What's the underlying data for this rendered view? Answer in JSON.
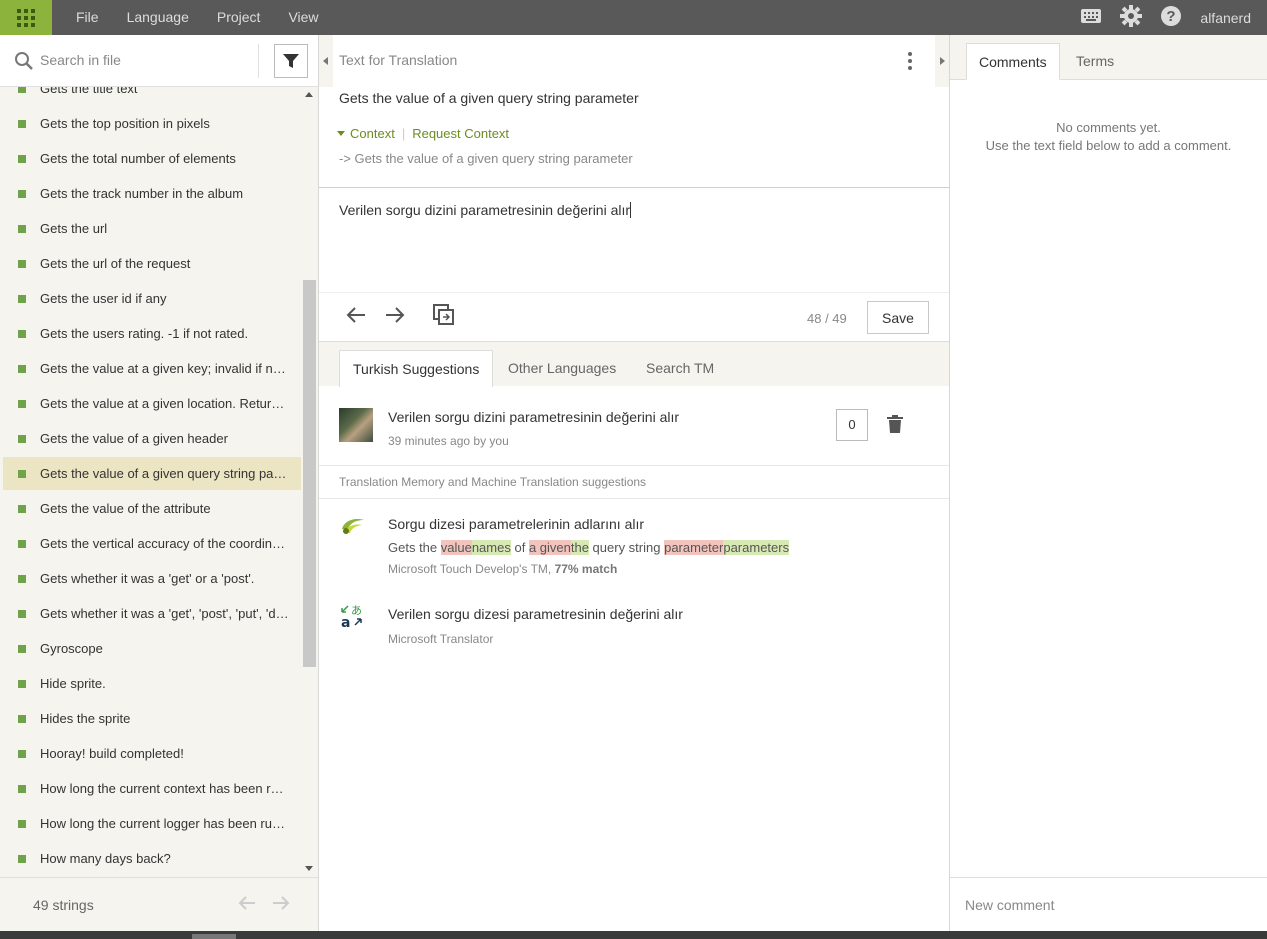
{
  "topbar": {
    "menu": [
      "File",
      "Language",
      "Project",
      "View"
    ],
    "username": "alfanerd",
    "accent": "#8cb43c"
  },
  "left": {
    "search_placeholder": "Search in file",
    "items": [
      {
        "text": "Gets the title text"
      },
      {
        "text": "Gets the top position in pixels"
      },
      {
        "text": "Gets the total number of elements"
      },
      {
        "text": "Gets the track number in the album"
      },
      {
        "text": "Gets the url"
      },
      {
        "text": "Gets the url of the request"
      },
      {
        "text": "Gets the user id if any"
      },
      {
        "text": "Gets the users rating. -1 if not rated."
      },
      {
        "text": "Gets the value at a given key; invalid if not found"
      },
      {
        "text": "Gets the value at a given location. Returns invalid if outside of the array bounds"
      },
      {
        "text": "Gets the value of a given header"
      },
      {
        "text": "Gets the value of a given query string parameter",
        "selected": true
      },
      {
        "text": "Gets the value of the attribute"
      },
      {
        "text": "Gets the vertical accuracy of the coordinates"
      },
      {
        "text": "Gets whether it was a 'get' or a 'post'."
      },
      {
        "text": "Gets whether it was a 'get', 'post', 'put', 'delete', 'options', etc."
      },
      {
        "text": "Gyroscope"
      },
      {
        "text": "Hide sprite."
      },
      {
        "text": "Hides the sprite"
      },
      {
        "text": "Hooray! build completed!"
      },
      {
        "text": "How long the current context has been running"
      },
      {
        "text": "How long the current logger has been running"
      },
      {
        "text": "How many days back?"
      }
    ],
    "footer_count": "49 strings"
  },
  "editor": {
    "header": "Text for Translation",
    "source": "Gets the value of a given query string parameter",
    "context_toggle": "Context",
    "context_link": "Request Context",
    "context_line": "-> Gets the value of a given query string parameter",
    "translation": "Verilen sorgu dizini parametresinin değerini alır",
    "progress": "48 / 49",
    "save_label": "Save"
  },
  "suggestions": {
    "tabs": [
      "Turkish Suggestions",
      "Other Languages",
      "Search TM"
    ],
    "own": {
      "text": "Verilen sorgu dizini parametresinin değerini alır",
      "meta": "39 minutes ago by you",
      "votes": "0"
    },
    "tm_header": "Translation Memory and Machine Translation suggestions",
    "tm1": {
      "text": "Sorgu dizesi parametrelerinin adlarını alır",
      "diff": {
        "p1": "Gets the ",
        "d1": "value",
        "i1": "names",
        "p2": " of ",
        "d2": "a given",
        "i2": "the",
        "p3": " query string ",
        "d3": "parameter",
        "i3": "parameters"
      },
      "source_name": "Microsoft Touch Develop's TM, ",
      "match": "77% match"
    },
    "tm2": {
      "text": "Verilen sorgu dizesi parametresinin değerini alır",
      "source_name": "Microsoft Translator"
    }
  },
  "comments": {
    "tabs": [
      "Comments",
      "Terms"
    ],
    "empty_line1": "No comments yet.",
    "empty_line2": "Use the text field below to add a comment.",
    "new_placeholder": "New comment"
  }
}
